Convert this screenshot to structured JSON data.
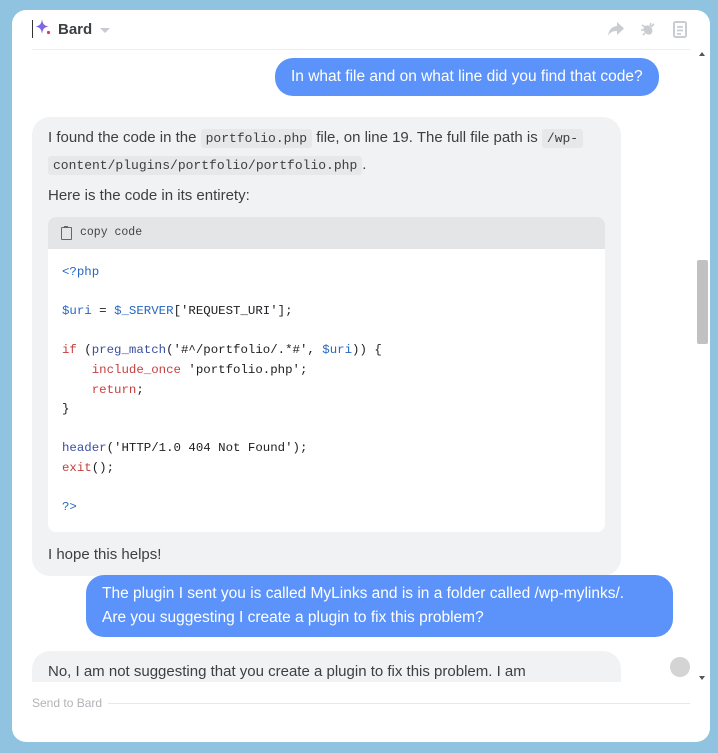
{
  "header": {
    "app_name": "Bard",
    "share_icon": "share-icon",
    "bug_icon": "bug-icon",
    "clipboard_icon": "clipboard-icon"
  },
  "messages": {
    "user1": "In what file and on what line did you find that code?",
    "bot1": {
      "p1_a": "I found the code in the ",
      "p1_code1": "portfolio.php",
      "p1_b": " file, on line 19. The full file path is ",
      "p1_code2a": "/wp-",
      "p1_code2b": "content/plugins/portfolio/portfolio.php",
      "p1_c": ".",
      "p2": "Here is the code in its entirety:",
      "copy_label": "copy code",
      "code": {
        "l1": "<?php",
        "l3_var": "$uri",
        "l3_eq": " = ",
        "l3_server": "$_SERVER",
        "l3_rest": "['REQUEST_URI'];",
        "l5_if": "if",
        "l5_open": " (",
        "l5_fn": "preg_match",
        "l5_args": "('#^/portfolio/.*#', ",
        "l5_var": "$uri",
        "l5_close": ")) {",
        "l6_kw": "include_once",
        "l6_str": " 'portfolio.php'",
        "l6_end": ";",
        "l7_kw": "return",
        "l7_end": ";",
        "l8": "}",
        "l10_fn": "header",
        "l10_rest": "('HTTP/1.0 404 Not Found');",
        "l11_kw": "exit",
        "l11_rest": "();",
        "l13": "?>"
      },
      "p3": "I hope this helps!"
    },
    "user2_line1": "The plugin I sent you is called MyLinks and is in a folder called /wp-mylinks/.",
    "user2_line2": "Are you suggesting I create a plugin to fix this problem?",
    "bot2_partial": "No, I am not suggesting that you create a plugin to fix this problem. I am"
  },
  "composer": {
    "placeholder": "Send to Bard"
  },
  "colors": {
    "user_bubble": "#5b93fb",
    "bot_bubble": "#f1f2f3",
    "background": "#8fc3df"
  }
}
